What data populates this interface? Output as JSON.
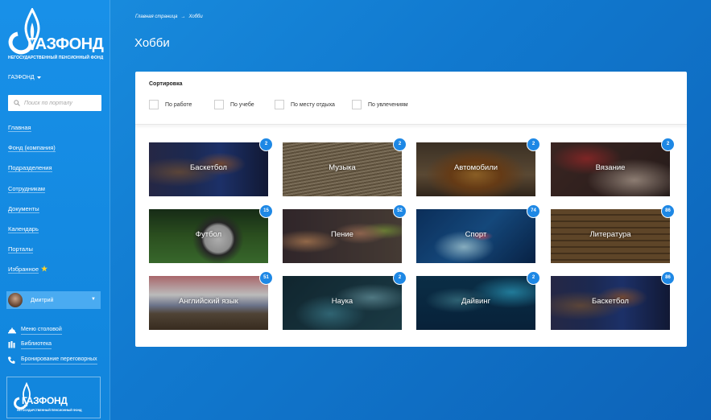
{
  "brand": {
    "logo_text": "ГАЗФОНД",
    "logo_subtitle": "НЕГОСУДАРСТВЕННЫЙ ПЕНСИОННЫЙ ФОНД"
  },
  "sidebar": {
    "org_selector": "ГАЗФОНД",
    "search_placeholder": "Поиск по порталу",
    "nav_items": [
      {
        "label": "Главная"
      },
      {
        "label": "Фонд (компания)"
      },
      {
        "label": "Подразделения"
      },
      {
        "label": "Сотрудникам"
      },
      {
        "label": "Документы"
      },
      {
        "label": "Календарь"
      },
      {
        "label": "Порталы"
      },
      {
        "label": "Избранное"
      }
    ],
    "user": {
      "name": "Дмитрий"
    },
    "quick_links": [
      {
        "label": "Меню столовой",
        "icon": "tray-icon"
      },
      {
        "label": "Библиотека",
        "icon": "books-icon"
      },
      {
        "label": "Бронирование переговорных",
        "icon": "phone-icon"
      }
    ]
  },
  "breadcrumb": {
    "home": "Главная страница",
    "separator": "→",
    "current": "Хобби"
  },
  "page": {
    "title": "Хобби"
  },
  "sort": {
    "title": "Сортировка",
    "filters": [
      {
        "label": "По работе"
      },
      {
        "label": "По учебе"
      },
      {
        "label": "По месту отдыха"
      },
      {
        "label": "По увлечениям"
      }
    ]
  },
  "hobbies": [
    {
      "label": "Баскетбол",
      "count": "2"
    },
    {
      "label": "Музыка",
      "count": "2"
    },
    {
      "label": "Автомобили",
      "count": "2"
    },
    {
      "label": "Вязание",
      "count": "2"
    },
    {
      "label": "Футбол",
      "count": "15"
    },
    {
      "label": "Пение",
      "count": "52"
    },
    {
      "label": "Спорт",
      "count": "74"
    },
    {
      "label": "Литература",
      "count": "86"
    },
    {
      "label": "Английский язык",
      "count": "51"
    },
    {
      "label": "Наука",
      "count": "2"
    },
    {
      "label": "Дайвинг",
      "count": "2"
    },
    {
      "label": "Баскетбол",
      "count": "86"
    }
  ],
  "colors": {
    "accent": "#1e88e5",
    "background": "#1179cf",
    "favorite_star": "#ffd32a"
  }
}
